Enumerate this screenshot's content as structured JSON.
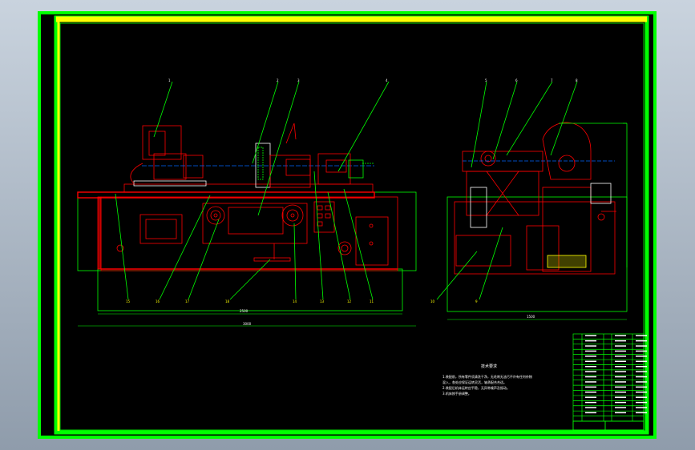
{
  "drawing": {
    "background": "#000000",
    "frame_color": "#00ff00",
    "inner_frame_color": "#ffff00",
    "machine_color": "#ff0000",
    "tech_requirements_title": "技术要求",
    "tech_requirements": [
      "1.装配前，所有零件须清洗干净，无毛刺无油污不许有任何杂物",
      "混入，各处应保证运转灵活，轴承配合合适。",
      "2.装配后机床运转应平稳，无异常噪声及振动。",
      "3.机床按手册调整。"
    ],
    "front_view_callouts": [
      "1",
      "2",
      "3",
      "4",
      "15",
      "16",
      "17",
      "18",
      "19",
      "14",
      "13",
      "12",
      "11"
    ],
    "side_view_callouts": [
      "5",
      "6",
      "7",
      "8",
      "9",
      "10"
    ],
    "bom_rows": 17
  }
}
